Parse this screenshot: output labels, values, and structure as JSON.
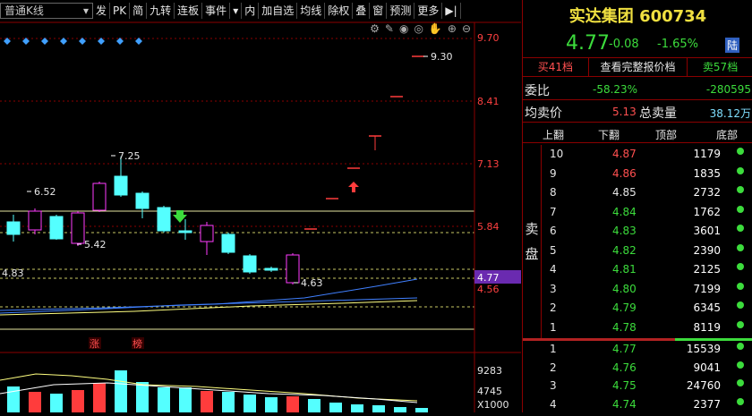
{
  "toolbar": {
    "select_value": "普通K线",
    "buttons": [
      "发",
      "PK",
      "简",
      "九转",
      "连板",
      "事件",
      "内",
      "加自选",
      "均线",
      "除权",
      "叠",
      "窗",
      "预测",
      "更多"
    ],
    "arrow": "▶|"
  },
  "chart": {
    "price_labels": [
      "9.70",
      "8.41",
      "7.13",
      "5.84",
      "4.56"
    ],
    "current_price_tag": "4.77",
    "volume_labels": [
      "9283",
      "4745",
      "X1000"
    ],
    "annotations": {
      "a": "6.52",
      "b": "7.25",
      "c": "5.42",
      "d": "4.83",
      "e": "4.63",
      "f": "9.30"
    },
    "marks": [
      "涨",
      "榜"
    ],
    "colors": {
      "up": "#ff3c3c",
      "down": "#54ffff",
      "ma1": "#ffff80",
      "ma2": "#4080ff",
      "ma3": "#ffffff"
    }
  },
  "quote": {
    "name": "实达集团",
    "code": "600734",
    "price": "4.77",
    "change": "-0.08",
    "pct": "-1.65%",
    "market": "陆",
    "tab_buy": "买41档",
    "tab_mid": "查看完整报价档",
    "tab_sell": "卖57档",
    "weibi_label": "委比",
    "weibi_value": "-58.23%",
    "weicha_value": "-280595",
    "avg_sell_label": "均卖价",
    "avg_sell_value": "5.13",
    "total_sell_label": "总卖量",
    "total_sell_value": "38.12万",
    "head": [
      "上翻",
      "下翻",
      "顶部",
      "底部"
    ],
    "sell_label": "卖盘",
    "sell": [
      {
        "lvl": "10",
        "price": "4.87",
        "vol": "1179",
        "color": "#ff5050"
      },
      {
        "lvl": "9",
        "price": "4.86",
        "vol": "1835",
        "color": "#ff5050"
      },
      {
        "lvl": "8",
        "price": "4.85",
        "vol": "2732",
        "color": "#e6e6e6"
      },
      {
        "lvl": "7",
        "price": "4.84",
        "vol": "1762",
        "color": "#3cdc3c"
      },
      {
        "lvl": "6",
        "price": "4.83",
        "vol": "3601",
        "color": "#3cdc3c"
      },
      {
        "lvl": "5",
        "price": "4.82",
        "vol": "2390",
        "color": "#3cdc3c"
      },
      {
        "lvl": "4",
        "price": "4.81",
        "vol": "2125",
        "color": "#3cdc3c"
      },
      {
        "lvl": "3",
        "price": "4.80",
        "vol": "7199",
        "color": "#3cdc3c"
      },
      {
        "lvl": "2",
        "price": "4.79",
        "vol": "6345",
        "color": "#3cdc3c"
      },
      {
        "lvl": "1",
        "price": "4.78",
        "vol": "8119",
        "color": "#3cdc3c"
      }
    ],
    "buy": [
      {
        "lvl": "1",
        "price": "4.77",
        "vol": "15539",
        "color": "#3cdc3c"
      },
      {
        "lvl": "2",
        "price": "4.76",
        "vol": "9041",
        "color": "#3cdc3c"
      },
      {
        "lvl": "3",
        "price": "4.75",
        "vol": "24760",
        "color": "#3cdc3c"
      },
      {
        "lvl": "4",
        "price": "4.74",
        "vol": "2377",
        "color": "#3cdc3c"
      }
    ]
  }
}
